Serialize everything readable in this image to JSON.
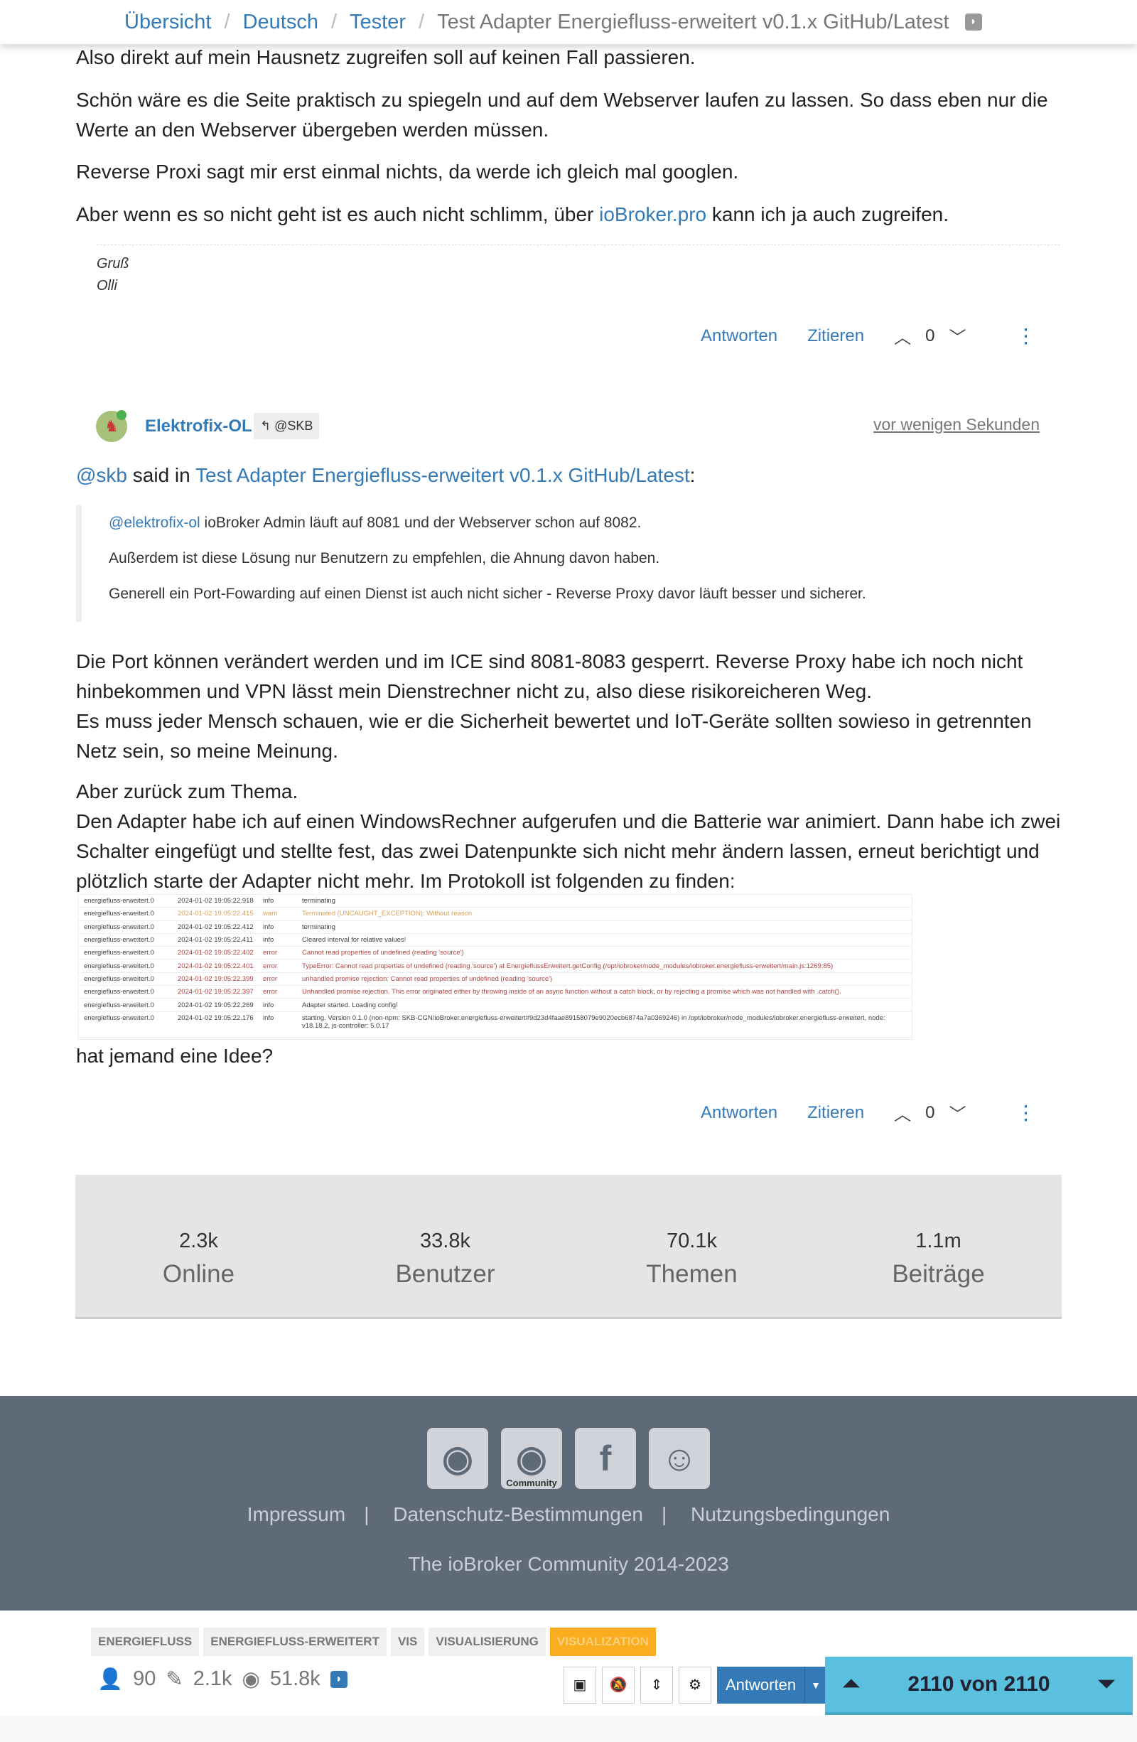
{
  "breadcrumb": {
    "items": [
      "Übersicht",
      "Deutsch",
      "Tester"
    ],
    "current": "Test Adapter Energiefluss-erweitert v0.1.x GitHub/Latest"
  },
  "post1": {
    "p1": "Also direkt auf mein Hausnetz zugreifen soll auf keinen Fall passieren.",
    "p2": "Schön wäre es die Seite praktisch zu spiegeln und auf dem Webserver laufen zu lassen. So dass eben nur die Werte an den Webserver übergeben werden müssen.",
    "p3": "Reverse Proxi sagt mir erst einmal nichts, da werde ich gleich mal googlen.",
    "p4a": "Aber wenn es so nicht geht ist es auch nicht schlimm, über ",
    "p4link": "ioBroker.pro",
    "p4b": " kann ich ja auch zugreifen.",
    "sig1": "Gruß",
    "sig2": "Olli"
  },
  "actions": {
    "reply": "Antworten",
    "quote": "Zitieren",
    "votes": "0"
  },
  "post2": {
    "author": "Elektrofix-OL",
    "reply_to": "@SKB",
    "time": "vor wenigen Sekunden",
    "said_user": "@skb",
    "said_in": " said in ",
    "said_topic": "Test Adapter Energiefluss-erweitert v0.1.x GitHub/Latest",
    "colon": ":",
    "quote": {
      "mention": "@elektrofix-ol",
      "l1": " ioBroker Admin läuft auf 8081 und der Webserver schon auf 8082.",
      "l2": "Außerdem ist diese Lösung nur Benutzern zu empfehlen, die Ahnung davon haben.",
      "l3": "Generell ein Port-Fowarding auf einen Dienst ist auch nicht sicher - Reverse Proxy davor läuft besser und sicherer."
    },
    "p1": "Die Port können verändert werden und im ICE sind 8081-8083 gesperrt. Reverse Proxy habe ich noch nicht hinbekommen und VPN lässt mein Dienstrechner nicht zu, also diese risikoreicheren Weg.",
    "p2": "Es muss jeder Mensch schauen, wie er die Sicherheit bewertet und IoT-Geräte sollten sowieso in getrennten Netz sein, so meine Meinung.",
    "p3": "Aber zurück zum Thema.",
    "p4": "Den Adapter habe ich auf einen WindowsRechner aufgerufen und die Batterie war animiert. Dann habe ich zwei Schalter eingefügt und stellte fest, das zwei Datenpunkte sich nicht mehr ändern lassen, erneut berichtigt und plötzlich starte der Adapter nicht mehr. Im Protokoll ist folgenden zu finden:",
    "p5": "hat jemand eine Idee?"
  },
  "log": [
    {
      "src": "energiefluss-erweitert.0",
      "time": "2024-01-02 19:05:22.918",
      "level": "info",
      "msg": "terminating"
    },
    {
      "src": "energiefluss-erweitert.0",
      "time": "2024-01-02 19:05:22.415",
      "level": "warn",
      "msg": "Terminated (UNCAUGHT_EXCEPTION): Without reason"
    },
    {
      "src": "energiefluss-erweitert.0",
      "time": "2024-01-02 19:05:22.412",
      "level": "info",
      "msg": "terminating"
    },
    {
      "src": "energiefluss-erweitert.0",
      "time": "2024-01-02 19:05:22.411",
      "level": "info",
      "msg": "Cleared interval for relative values!"
    },
    {
      "src": "energiefluss-erweitert.0",
      "time": "2024-01-02 19:05:22.402",
      "level": "error",
      "msg": "Cannot read properties of undefined (reading 'source')"
    },
    {
      "src": "energiefluss-erweitert.0",
      "time": "2024-01-02 19:05:22.401",
      "level": "error",
      "msg": "TypeError: Cannot read properties of undefined (reading 'source') at EnergieflussErweitert.getConfig (/opt/iobroker/node_modules/iobroker.energiefluss-erweitert/main.js:1269:85)"
    },
    {
      "src": "energiefluss-erweitert.0",
      "time": "2024-01-02 19:05:22.399",
      "level": "error",
      "msg": "unhandled promise rejection: Cannot read properties of undefined (reading 'source')"
    },
    {
      "src": "energiefluss-erweitert.0",
      "time": "2024-01-02 19:05:22.397",
      "level": "error",
      "msg": "Unhandled promise rejection. This error originated either by throwing inside of an async function without a catch block, or by rejecting a promise which was not handled with .catch()."
    },
    {
      "src": "energiefluss-erweitert.0",
      "time": "2024-01-02 19:05:22.269",
      "level": "info",
      "msg": "Adapter started. Loading config!"
    },
    {
      "src": "energiefluss-erweitert.0",
      "time": "2024-01-02 19:05:22.176",
      "level": "info",
      "msg": "starting. Version 0.1.0 (non-npm: SKB-CGN/ioBroker.energiefluss-erweitert#9d23d4faae89158079e9020ecb6874a7a0369246) in /opt/iobroker/node_modules/iobroker.energiefluss-erweitert, node: v18.18.2, js-controller: 5.0.17"
    }
  ],
  "stats": [
    {
      "value": "2.3k",
      "label": "Online"
    },
    {
      "value": "33.8k",
      "label": "Benutzer"
    },
    {
      "value": "70.1k",
      "label": "Themen"
    },
    {
      "value": "1.1m",
      "label": "Beiträge"
    }
  ],
  "footer": {
    "icons": [
      "github-icon",
      "github-community-icon",
      "facebook-icon",
      "discord-icon"
    ],
    "community_label": "Community",
    "links": [
      "Impressum",
      "Datenschutz-Bestimmungen",
      "Nutzungsbedingungen"
    ],
    "copyright": "The ioBroker Community 2014-2023"
  },
  "tags": [
    "ENERGIEFLUSS",
    "ENERGIEFLUSS-ERWEITERT",
    "VIS",
    "VISUALISIERUNG",
    "VISUALIZATION"
  ],
  "topic_stats": {
    "posters": "90",
    "posts": "2.1k",
    "views": "51.8k"
  },
  "toolbar": {
    "reply": "Antworten",
    "pager": "2110 von 2110"
  },
  "colors": {
    "link": "#337ab7",
    "footer": "#5f6a78",
    "pager": "#5bc0de",
    "tag_highlight": "#f9ad1f"
  }
}
